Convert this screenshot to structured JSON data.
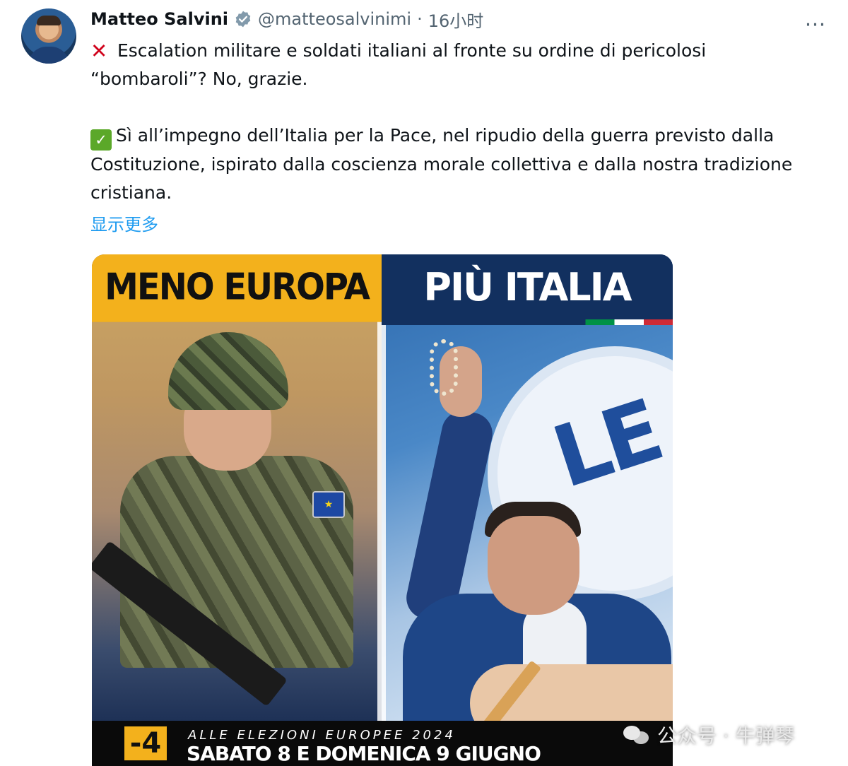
{
  "author": {
    "name": "Matteo Salvini",
    "handle": "@matteosalvinimi",
    "separator": "·",
    "time": "16小时"
  },
  "tweet": {
    "line1_emoji": "✕",
    "line1": "Escalation militare e soldati italiani al fronte su ordine di pericolosi “bombaroli”? No, grazie.",
    "line2_emoji": "✓",
    "line2": "Sì all’impegno dell’Italia per la Pace, nel ripudio della guerra previsto dalla Costituzione, ispirato dalla coscienza morale collettiva e dalla nostra tradizione cristiana.",
    "show_more": "显示更多"
  },
  "more_menu_icon": "more-horizontal-icon",
  "media": {
    "left_title": "MENO EUROPA",
    "right_title": "PIÙ ITALIA",
    "countdown": "-4",
    "election_line1": "ALLE ELEZIONI EUROPEE 2024",
    "election_line2": "SABATO 8 E DOMENICA 9 GIUGNO",
    "background_logo_text": "LE",
    "eu_patch": "★",
    "colors": {
      "left_banner": "#f3b11c",
      "right_banner": "#12305f",
      "italy_green": "#009246",
      "italy_red": "#ce2b37"
    }
  },
  "watermark": {
    "text": "公众号 · 牛弹琴"
  },
  "link_color": "#1d9bf0"
}
